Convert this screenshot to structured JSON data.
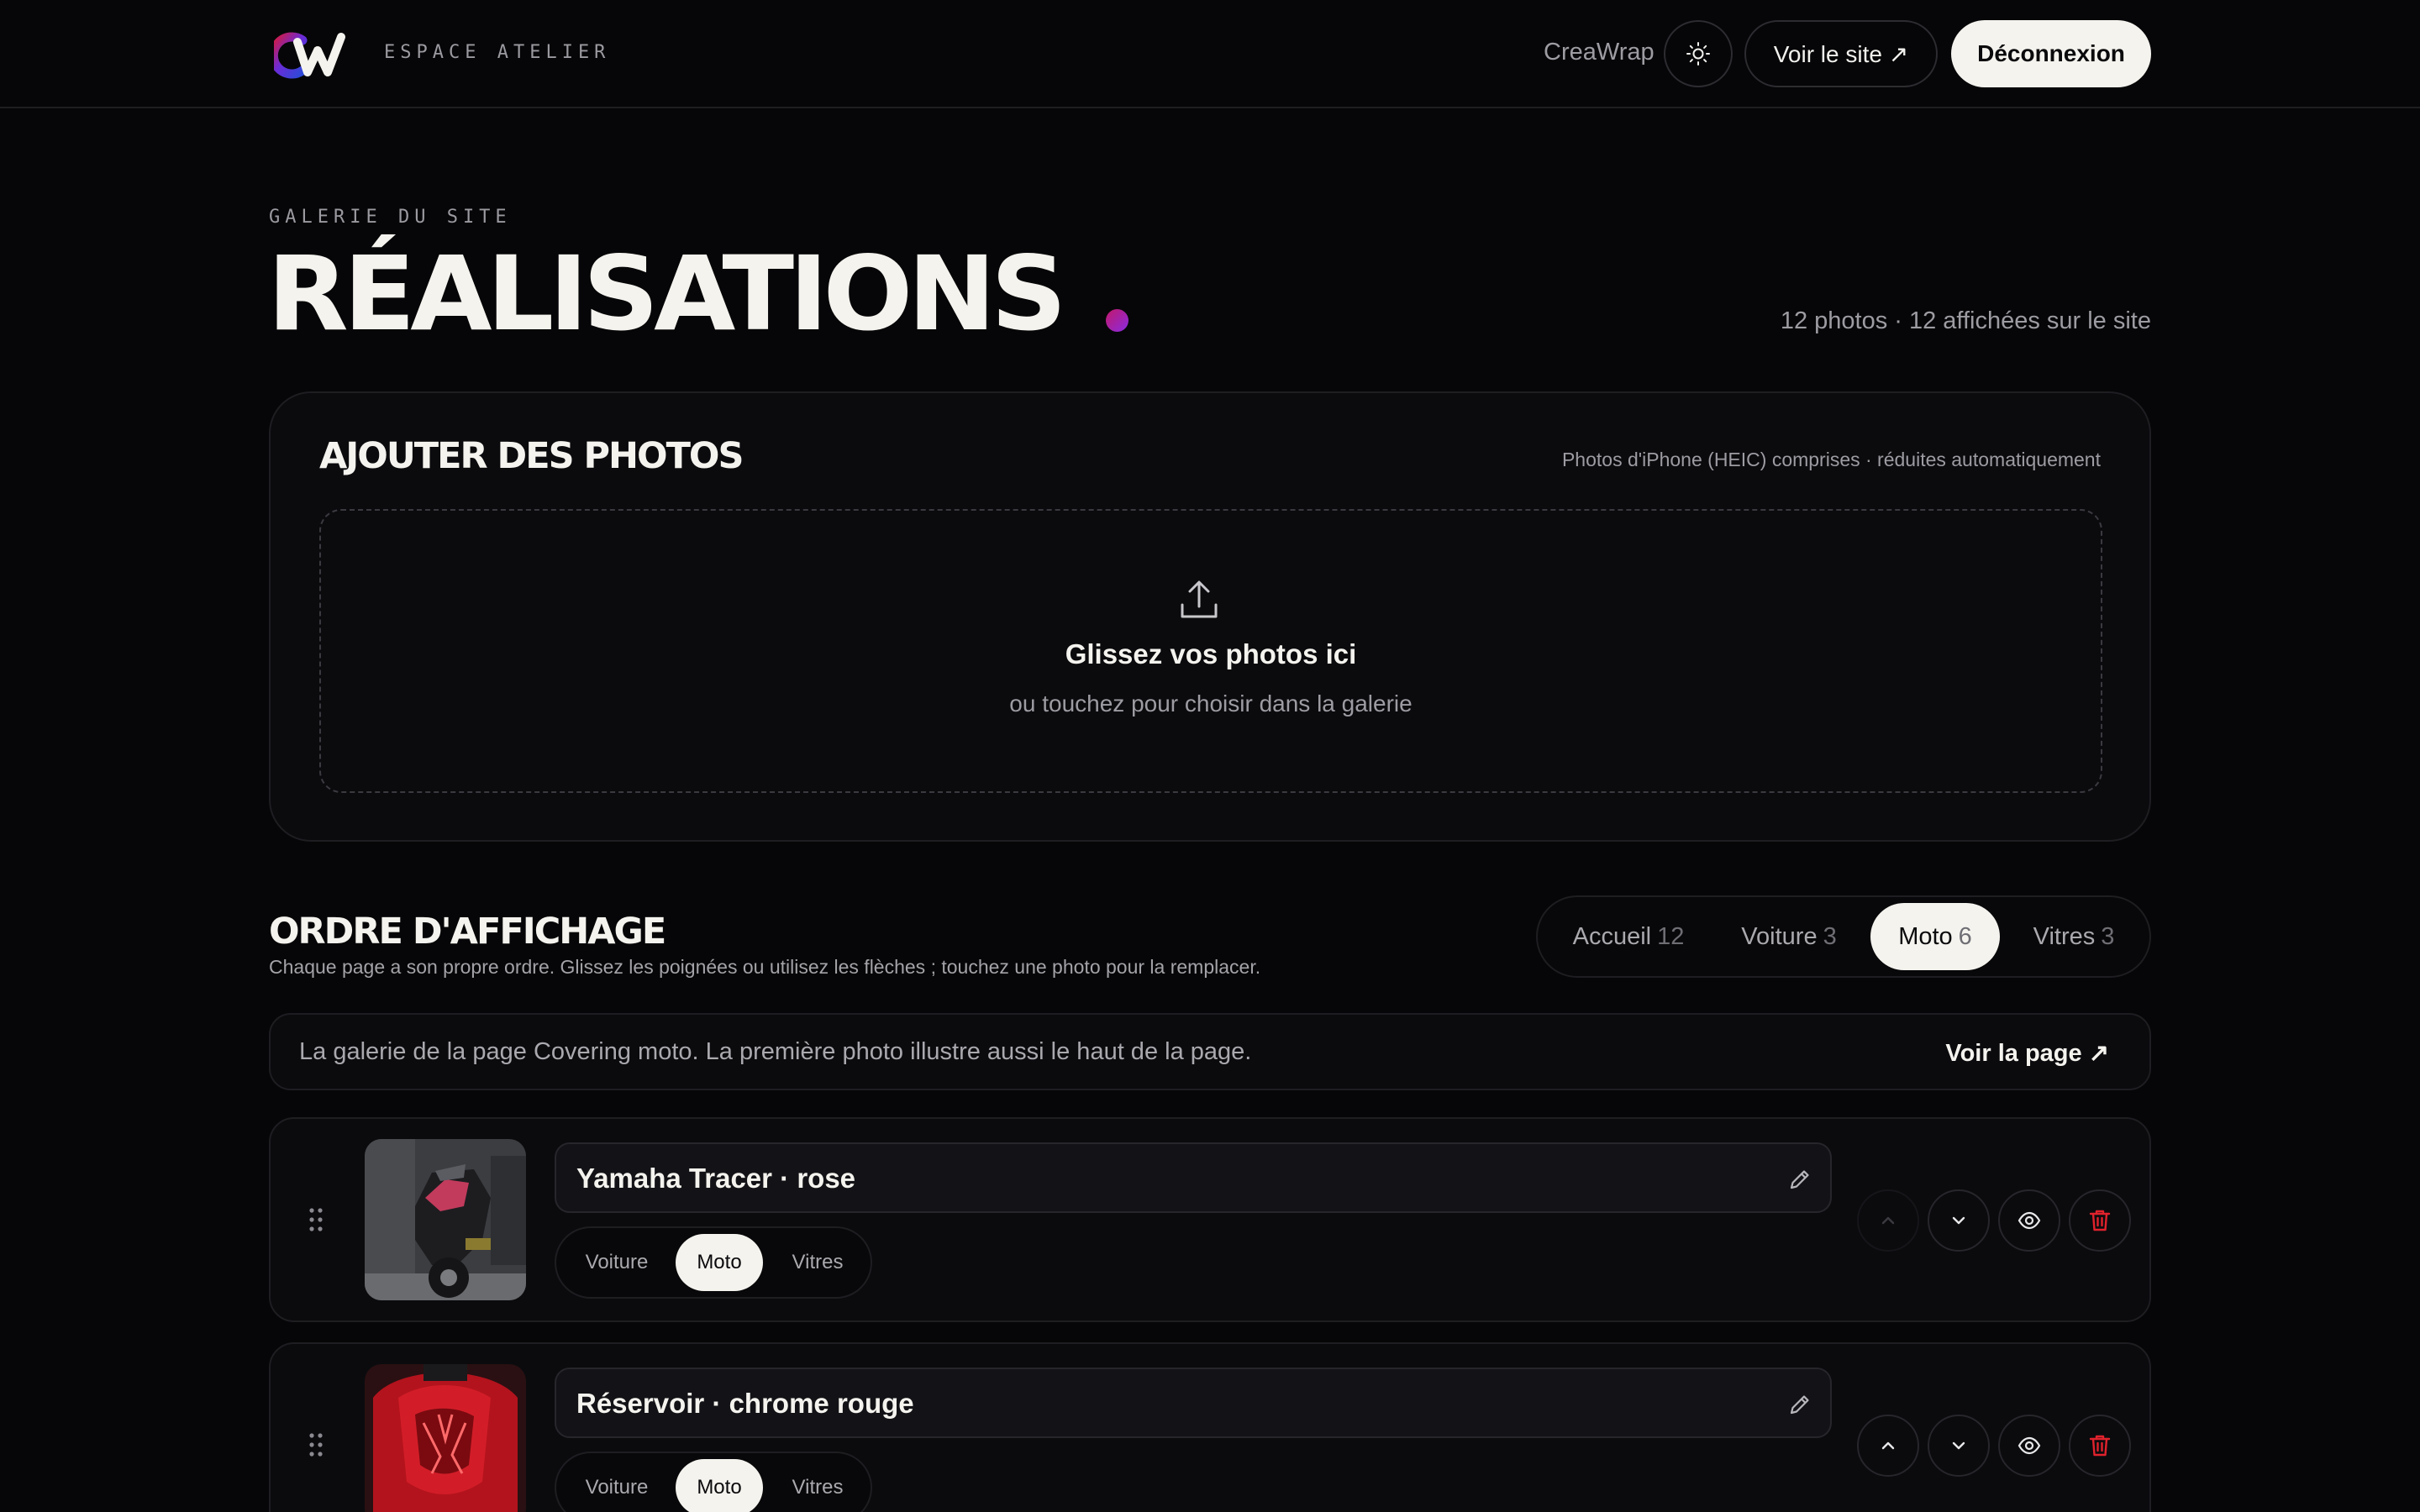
{
  "header": {
    "brand_sub": "ESPACE ATELIER",
    "site_name": "CreaWrap",
    "theme_icon": "sun-icon",
    "view_site_label": "Voir le site ↗",
    "logout_label": "Déconnexion"
  },
  "title_block": {
    "eyebrow": "GALERIE DU SITE",
    "title": "RÉALISATIONS",
    "photo_count": "12 photos · 12 affichées sur le site"
  },
  "upload": {
    "title": "AJOUTER DES PHOTOS",
    "hint": "Photos d'iPhone (HEIC) comprises · réduites automatiquement",
    "drop_title": "Glissez vos photos ici",
    "drop_sub": "ou touchez pour choisir dans la galerie"
  },
  "order": {
    "title": "ORDRE D'AFFICHAGE",
    "subtitle": "Chaque page a son propre ordre. Glissez les poignées ou utilisez les flèches ; touchez une photo pour la remplacer.",
    "tabs": [
      {
        "label": "Accueil",
        "count": "12",
        "active": false
      },
      {
        "label": "Voiture",
        "count": "3",
        "active": false
      },
      {
        "label": "Moto",
        "count": "6",
        "active": true
      },
      {
        "label": "Vitres",
        "count": "3",
        "active": false
      }
    ],
    "info_text": "La galerie de la page Covering moto. La première photo illustre aussi le haut de la page.",
    "info_link": "Voir la page ↗"
  },
  "photos": [
    {
      "name": "Yamaha Tracer · rose",
      "categories": [
        {
          "label": "Voiture",
          "active": false
        },
        {
          "label": "Moto",
          "active": true
        },
        {
          "label": "Vitres",
          "active": false
        }
      ],
      "up_disabled": true
    },
    {
      "name": "Réservoir · chrome rouge",
      "categories": [
        {
          "label": "Voiture",
          "active": false
        },
        {
          "label": "Moto",
          "active": true
        },
        {
          "label": "Vitres",
          "active": false
        }
      ],
      "up_disabled": false
    }
  ],
  "colors": {
    "background": "#060608",
    "accent_start": "#c2186a",
    "accent_end": "#8a2be2",
    "delete": "#e0222c"
  }
}
